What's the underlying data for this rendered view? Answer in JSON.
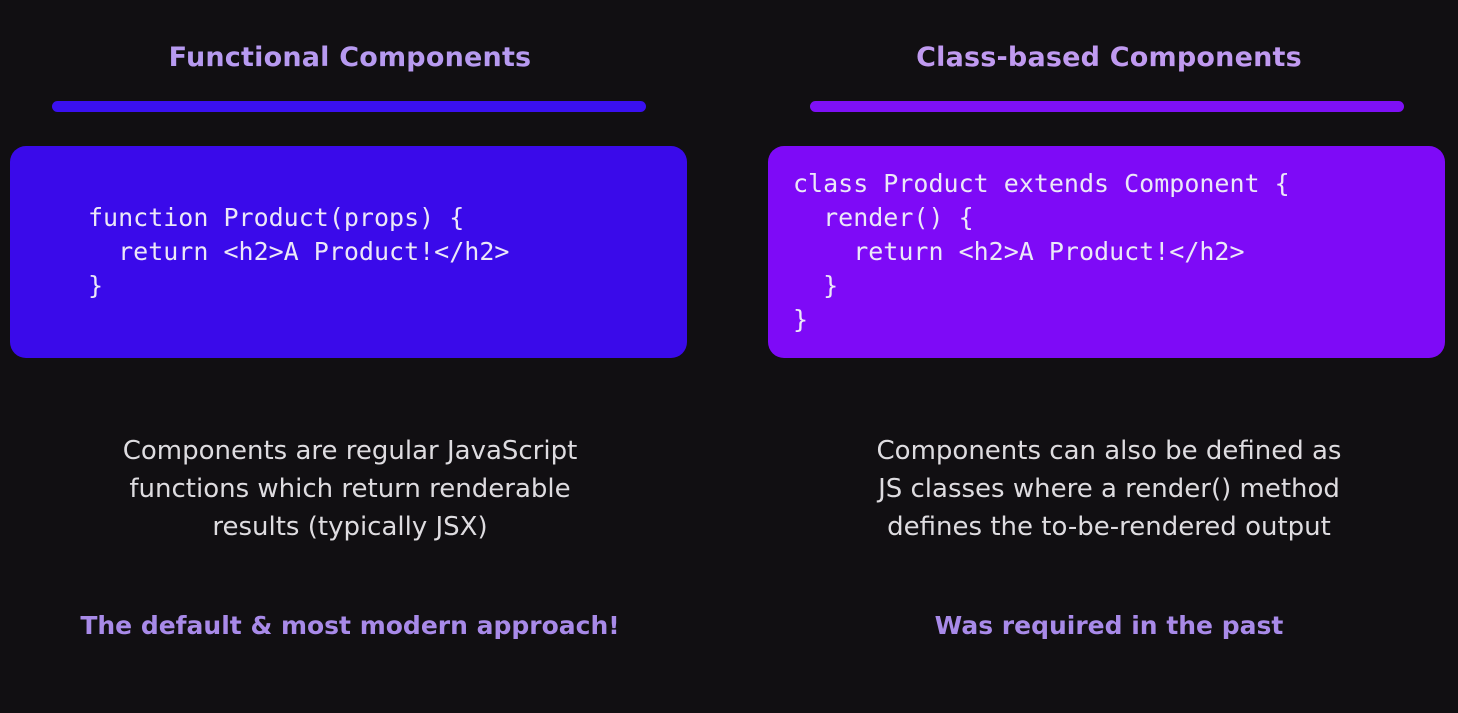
{
  "functional": {
    "heading": "Functional Components",
    "code_lines": [
      "function Product(props) {",
      "  return <h2>A Product!</h2>",
      "}"
    ],
    "description_lines": [
      "Components are regular JavaScript",
      "functions which return renderable",
      "results (typically JSX)"
    ],
    "tagline": "The default & most modern approach!",
    "accent_color": "#3a0aea"
  },
  "class_based": {
    "heading": "Class-based Components",
    "code_lines": [
      "class Product extends Component {",
      "  render() {",
      "    return <h2>A Product!</h2>",
      "  }",
      "}"
    ],
    "description_lines": [
      "Components can also be defined as",
      "JS classes where a render() method",
      "defines the to-be-rendered output"
    ],
    "tagline": "Was required in the past",
    "accent_color": "#7e0af7"
  }
}
